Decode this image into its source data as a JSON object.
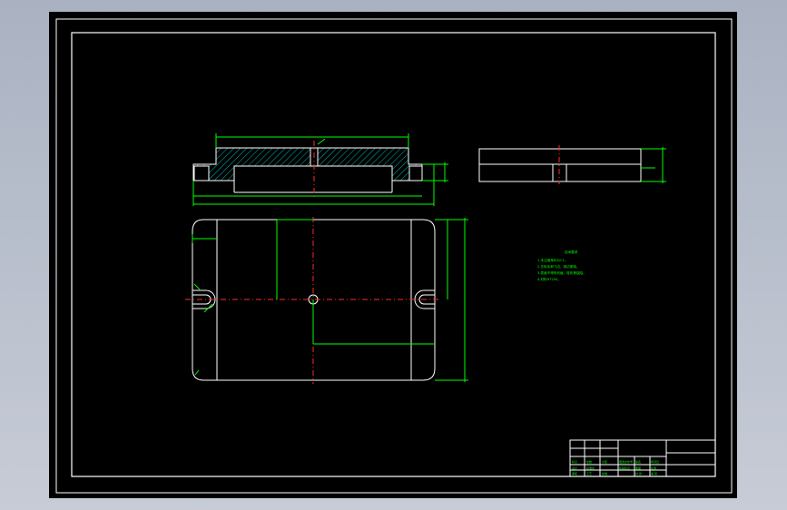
{
  "drawing": {
    "colors": {
      "outline": "#ffffff",
      "dimension": "#00ff00",
      "centerline": "#ff2a2a",
      "hatch": "#00b4b4",
      "background": "#000000"
    },
    "tech_requirements": {
      "title": "技术要求",
      "lines": [
        "1.未注倒角均为C1。",
        "2.去除毛刺飞边，锐边倒钝。",
        "3.表面不得有划痕、碰伤等缺陷。",
        "4.材料HT200。"
      ]
    },
    "title_block": {
      "cells": [
        "标记",
        "处数",
        "分区",
        "更改文件号",
        "签名",
        "年月日",
        "设计",
        "标准化",
        "阶段标记",
        "重量",
        "比例",
        "审核",
        "工艺",
        "批准",
        "共 张",
        "第 张"
      ]
    }
  }
}
